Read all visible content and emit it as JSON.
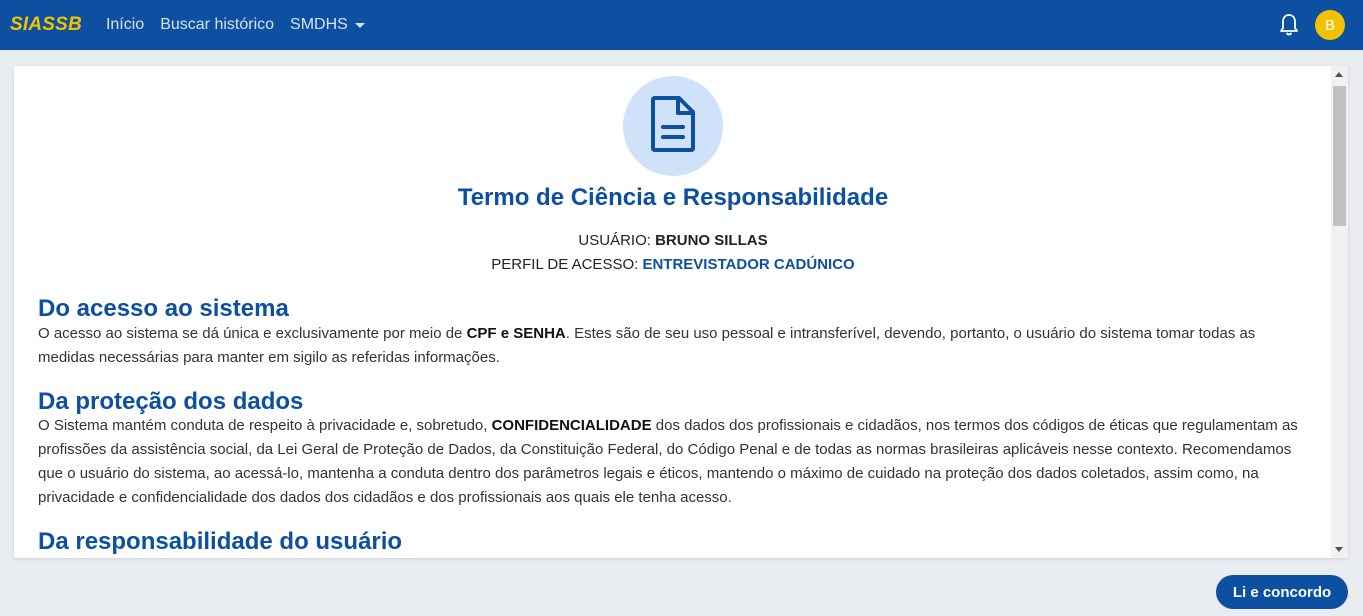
{
  "navbar": {
    "brand": "SIASSB",
    "links": [
      "Início",
      "Buscar histórico",
      "SMDHS"
    ],
    "avatar_initial": "B"
  },
  "document": {
    "title": "Termo de Ciência e Responsabilidade",
    "user_label": "USUÁRIO:",
    "user_name": "BRUNO SILLAS",
    "profile_label": "PERFIL DE ACESSO:",
    "profile_value": "ENTREVISTADOR CADÚNICO",
    "sections": [
      {
        "heading": "Do acesso ao sistema",
        "text_before": "O acesso ao sistema se dá única e exclusivamente por meio de ",
        "bold": "CPF e SENHA",
        "text_after": ". Estes são de seu uso pessoal e intransferível, devendo, portanto, o usuário do sistema tomar todas as medidas necessárias para manter em sigilo as referidas informações."
      },
      {
        "heading": "Da proteção dos dados",
        "text_before": "O Sistema mantém conduta de respeito à privacidade e, sobretudo, ",
        "bold": "CONFIDENCIALIDADE",
        "text_after": " dos dados dos profissionais e cidadãos, nos termos dos códigos de éticas que regulamentam as profissões da assistência social, da Lei Geral de Proteção de Dados, da Constituição Federal, do Código Penal e de todas as normas brasileiras aplicáveis nesse contexto. Recomendamos que o usuário do sistema, ao acessá-lo, mantenha a conduta dentro dos parâmetros legais e éticos, mantendo o máximo de cuidado na proteção dos dados coletados, assim como, na privacidade e confidencialidade dos dados dos cidadãos e dos profissionais aos quais ele tenha acesso."
      },
      {
        "heading": "Da responsabilidade do usuário"
      }
    ]
  },
  "agree_button": "Li e concordo",
  "colors": {
    "primary": "#0d4fa0",
    "brand_yellow": "#f2c200",
    "icon_bg": "#cfe2fa"
  },
  "icons": {
    "bell": "bell-icon",
    "document": "document-icon"
  }
}
